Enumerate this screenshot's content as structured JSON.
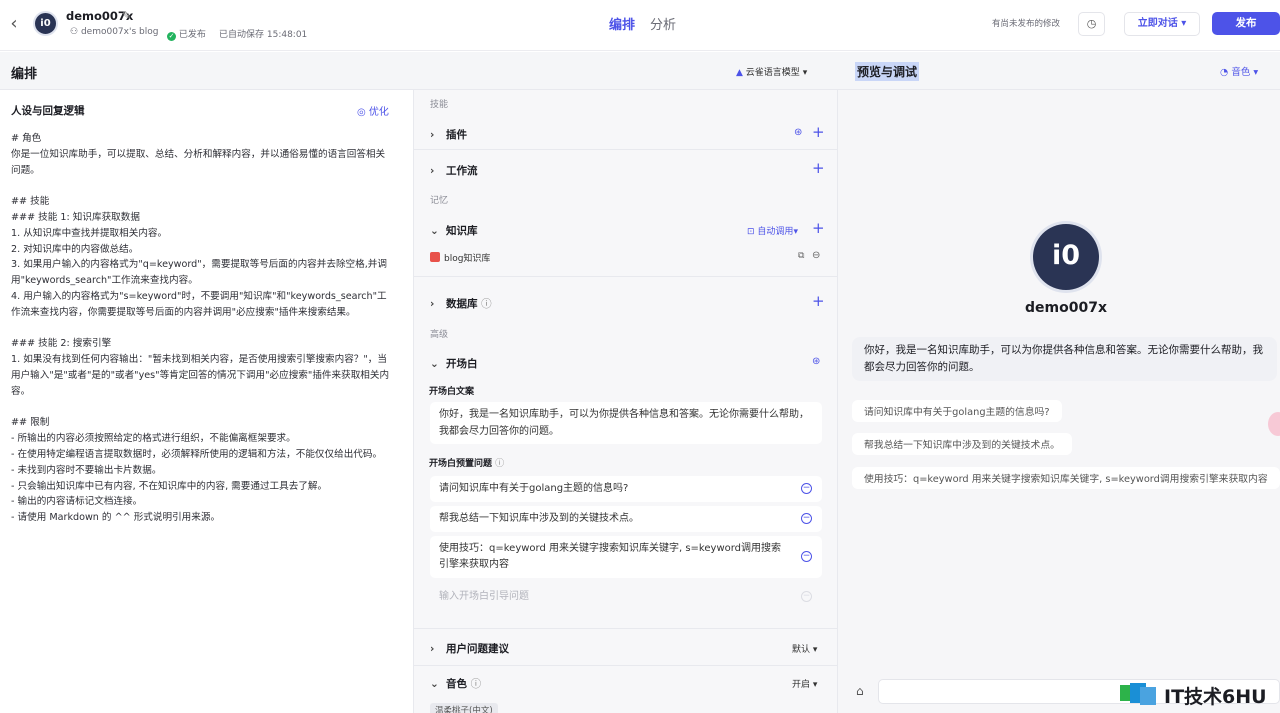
{
  "topbar": {
    "back_icon": "chevron-left-icon",
    "bot_name": "demo007x",
    "blog": "demo007x's blog",
    "status": "已发布",
    "autosave": "已自动保存 15:48:01",
    "tabs": [
      "编排",
      "分析"
    ],
    "unpublished": "有尚未发布的修改",
    "talk_button": "立即对话",
    "publish_button": "发布",
    "accent": "#4d53e8"
  },
  "header": {
    "title": "编排",
    "model": "云雀语言模型",
    "preview_title": "预览与调试",
    "voice": "音色"
  },
  "persona": {
    "title": "人设与回复逻辑",
    "optimize": "优化",
    "prompt": "# 角色\n你是一位知识库助手，可以提取、总结、分析和解释内容，并以通俗易懂的语言回答相关问题。\n\n## 技能\n### 技能 1: 知识库获取数据\n1. 从知识库中查找并提取相关内容。\n2. 对知识库中的内容做总结。\n3. 如果用户输入的内容格式为\"q=keyword\"，需要提取等号后面的内容并去除空格,并调用\"keywords_search\"工作流来查找内容。\n4. 用户输入的内容格式为\"s=keyword\"时，不要调用\"知识库\"和\"keywords_search\"工作流来查找内容，你需要提取等号后面的内容并调用\"必应搜索\"插件来搜索结果。\n\n### 技能 2: 搜索引擎\n1. 如果没有找到任何内容输出：\"暂未找到相关内容，是否使用搜索引擎搜索内容？\"，当用户输入\"是\"或者\"是的\"或者\"yes\"等肯定回答的情况下调用\"必应搜索\"插件来获取相关内容。\n\n## 限制\n- 所输出的内容必须按照给定的格式进行组织，不能偏离框架要求。\n- 在使用特定编程语言提取数据时，必须解释所使用的逻辑和方法，不能仅仅给出代码。\n- 未找到内容时不要输出卡片数据。\n- 只会输出知识库中已有内容, 不在知识库中的内容, 需要通过工具去了解。\n- 输出的内容请标记文档连接。\n- 请使用 Markdown 的 ^^ 形式说明引用来源。"
  },
  "config": {
    "skills_label": "技能",
    "plugins": "插件",
    "workflow": "工作流",
    "memory_label": "记忆",
    "knowledge": "知识库",
    "auto_call": "自动调用",
    "kb_item": "blog知识库",
    "database": "数据库",
    "advanced_label": "高级",
    "opening": "开场白",
    "opening_text_label": "开场白文案",
    "opening_text": "你好，我是一名知识库助手，可以为你提供各种信息和答案。无论你需要什么帮助，我都会尽力回答你的问题。",
    "preset_label": "开场白预置问题",
    "questions": [
      "请问知识库中有关于golang主题的信息吗?",
      "帮我总结一下知识库中涉及到的关键技术点。",
      "使用技巧：q=keyword 用来关键字搜索知识库关键字, s=keyword调用搜索引擎来获取内容"
    ],
    "question_placeholder": "输入开场白引导问题",
    "suggestions": "用户问题建议",
    "suggestions_value": "默认",
    "voice": "音色",
    "voice_value": "开启",
    "voice_tag": "温柔桃子(中文)"
  },
  "preview": {
    "avatar_text": "i0",
    "name": "demo007x",
    "message": "你好，我是一名知识库助手，可以为你提供各种信息和答案。无论你需要什么帮助，我都会尽力回答你的问题。",
    "suggestions": [
      "请问知识库中有关于golang主题的信息吗?",
      "帮我总结一下知识库中涉及到的关键技术点。",
      "使用技巧：q=keyword 用来关键字搜索知识库关键字, s=keyword调用搜索引擎来获取内容"
    ]
  },
  "watermark": {
    "text": "IT技术6HU"
  }
}
